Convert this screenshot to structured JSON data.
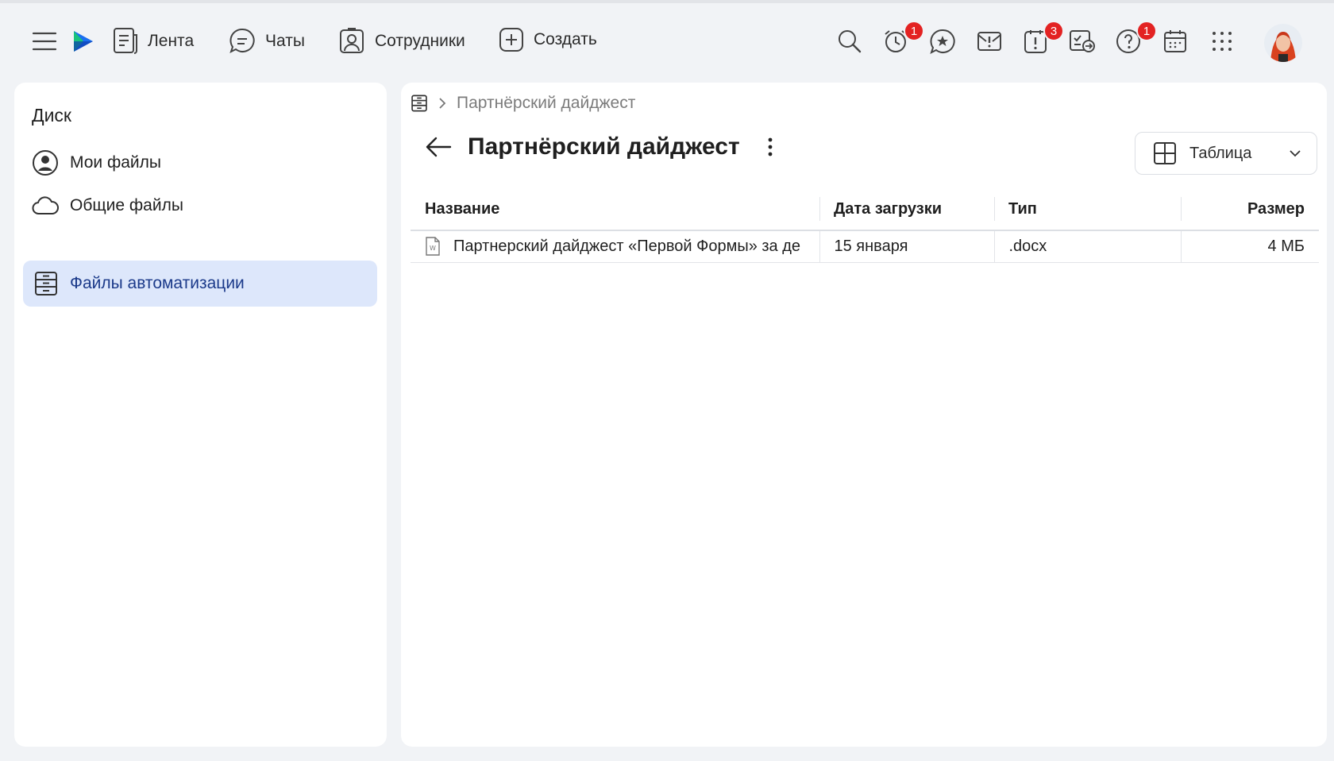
{
  "topbar": {
    "nav": [
      {
        "label": "Лента",
        "icon": "feed-icon"
      },
      {
        "label": "Чаты",
        "icon": "chat-icon"
      },
      {
        "label": "Сотрудники",
        "icon": "employees-icon"
      },
      {
        "label": "Создать",
        "icon": "plus-square-icon"
      }
    ],
    "badges": {
      "reminders": "1",
      "tasks": "3",
      "help": "1"
    },
    "colors": {
      "badge": "#e32222",
      "logo_blue": "#1b6ff0",
      "logo_green": "#19c37d"
    }
  },
  "sidebar": {
    "title": "Диск",
    "items": [
      {
        "label": "Мои файлы",
        "icon": "user-circle-icon"
      },
      {
        "label": "Общие файлы",
        "icon": "cloud-icon"
      },
      {
        "label": "Файлы автоматизации",
        "icon": "cabinet-icon",
        "active": true
      }
    ],
    "active_color": "#dde7fb"
  },
  "main": {
    "breadcrumb": "Партнёрский дайджест",
    "title": "Партнёрский дайджест",
    "view_select": {
      "label": "Таблица"
    },
    "table": {
      "headers": [
        "Название",
        "Дата загрузки",
        "Тип",
        "Размер"
      ],
      "rows": [
        {
          "name": "Партнерский дайджест «Первой Формы» за де",
          "date": "15 января",
          "type": ".docx",
          "size": "4 МБ"
        }
      ]
    }
  }
}
